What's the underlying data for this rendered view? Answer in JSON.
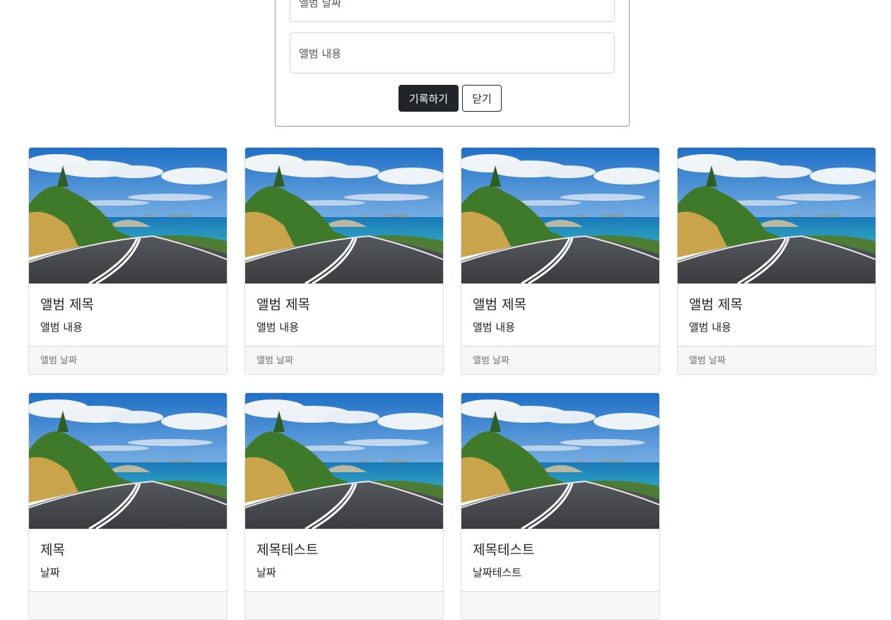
{
  "form": {
    "date_placeholder": "앨범 날짜",
    "content_placeholder": "앨범 내용",
    "record_label": "기록하기",
    "close_label": "닫기"
  },
  "cards": [
    {
      "title": "앨범 제목",
      "text": "앨범 내용",
      "footer": "앨범 날짜"
    },
    {
      "title": "앨범 제목",
      "text": "앨범 내용",
      "footer": "앨범 날짜"
    },
    {
      "title": "앨범 제목",
      "text": "앨범 내용",
      "footer": "앨범 날짜"
    },
    {
      "title": "앨범 제목",
      "text": "앨범 내용",
      "footer": "앨범 날짜"
    },
    {
      "title": "제목",
      "text": "날짜",
      "footer": ""
    },
    {
      "title": "제목테스트",
      "text": "날짜",
      "footer": ""
    },
    {
      "title": "제목테스트",
      "text": "날짜테스트",
      "footer": ""
    }
  ]
}
